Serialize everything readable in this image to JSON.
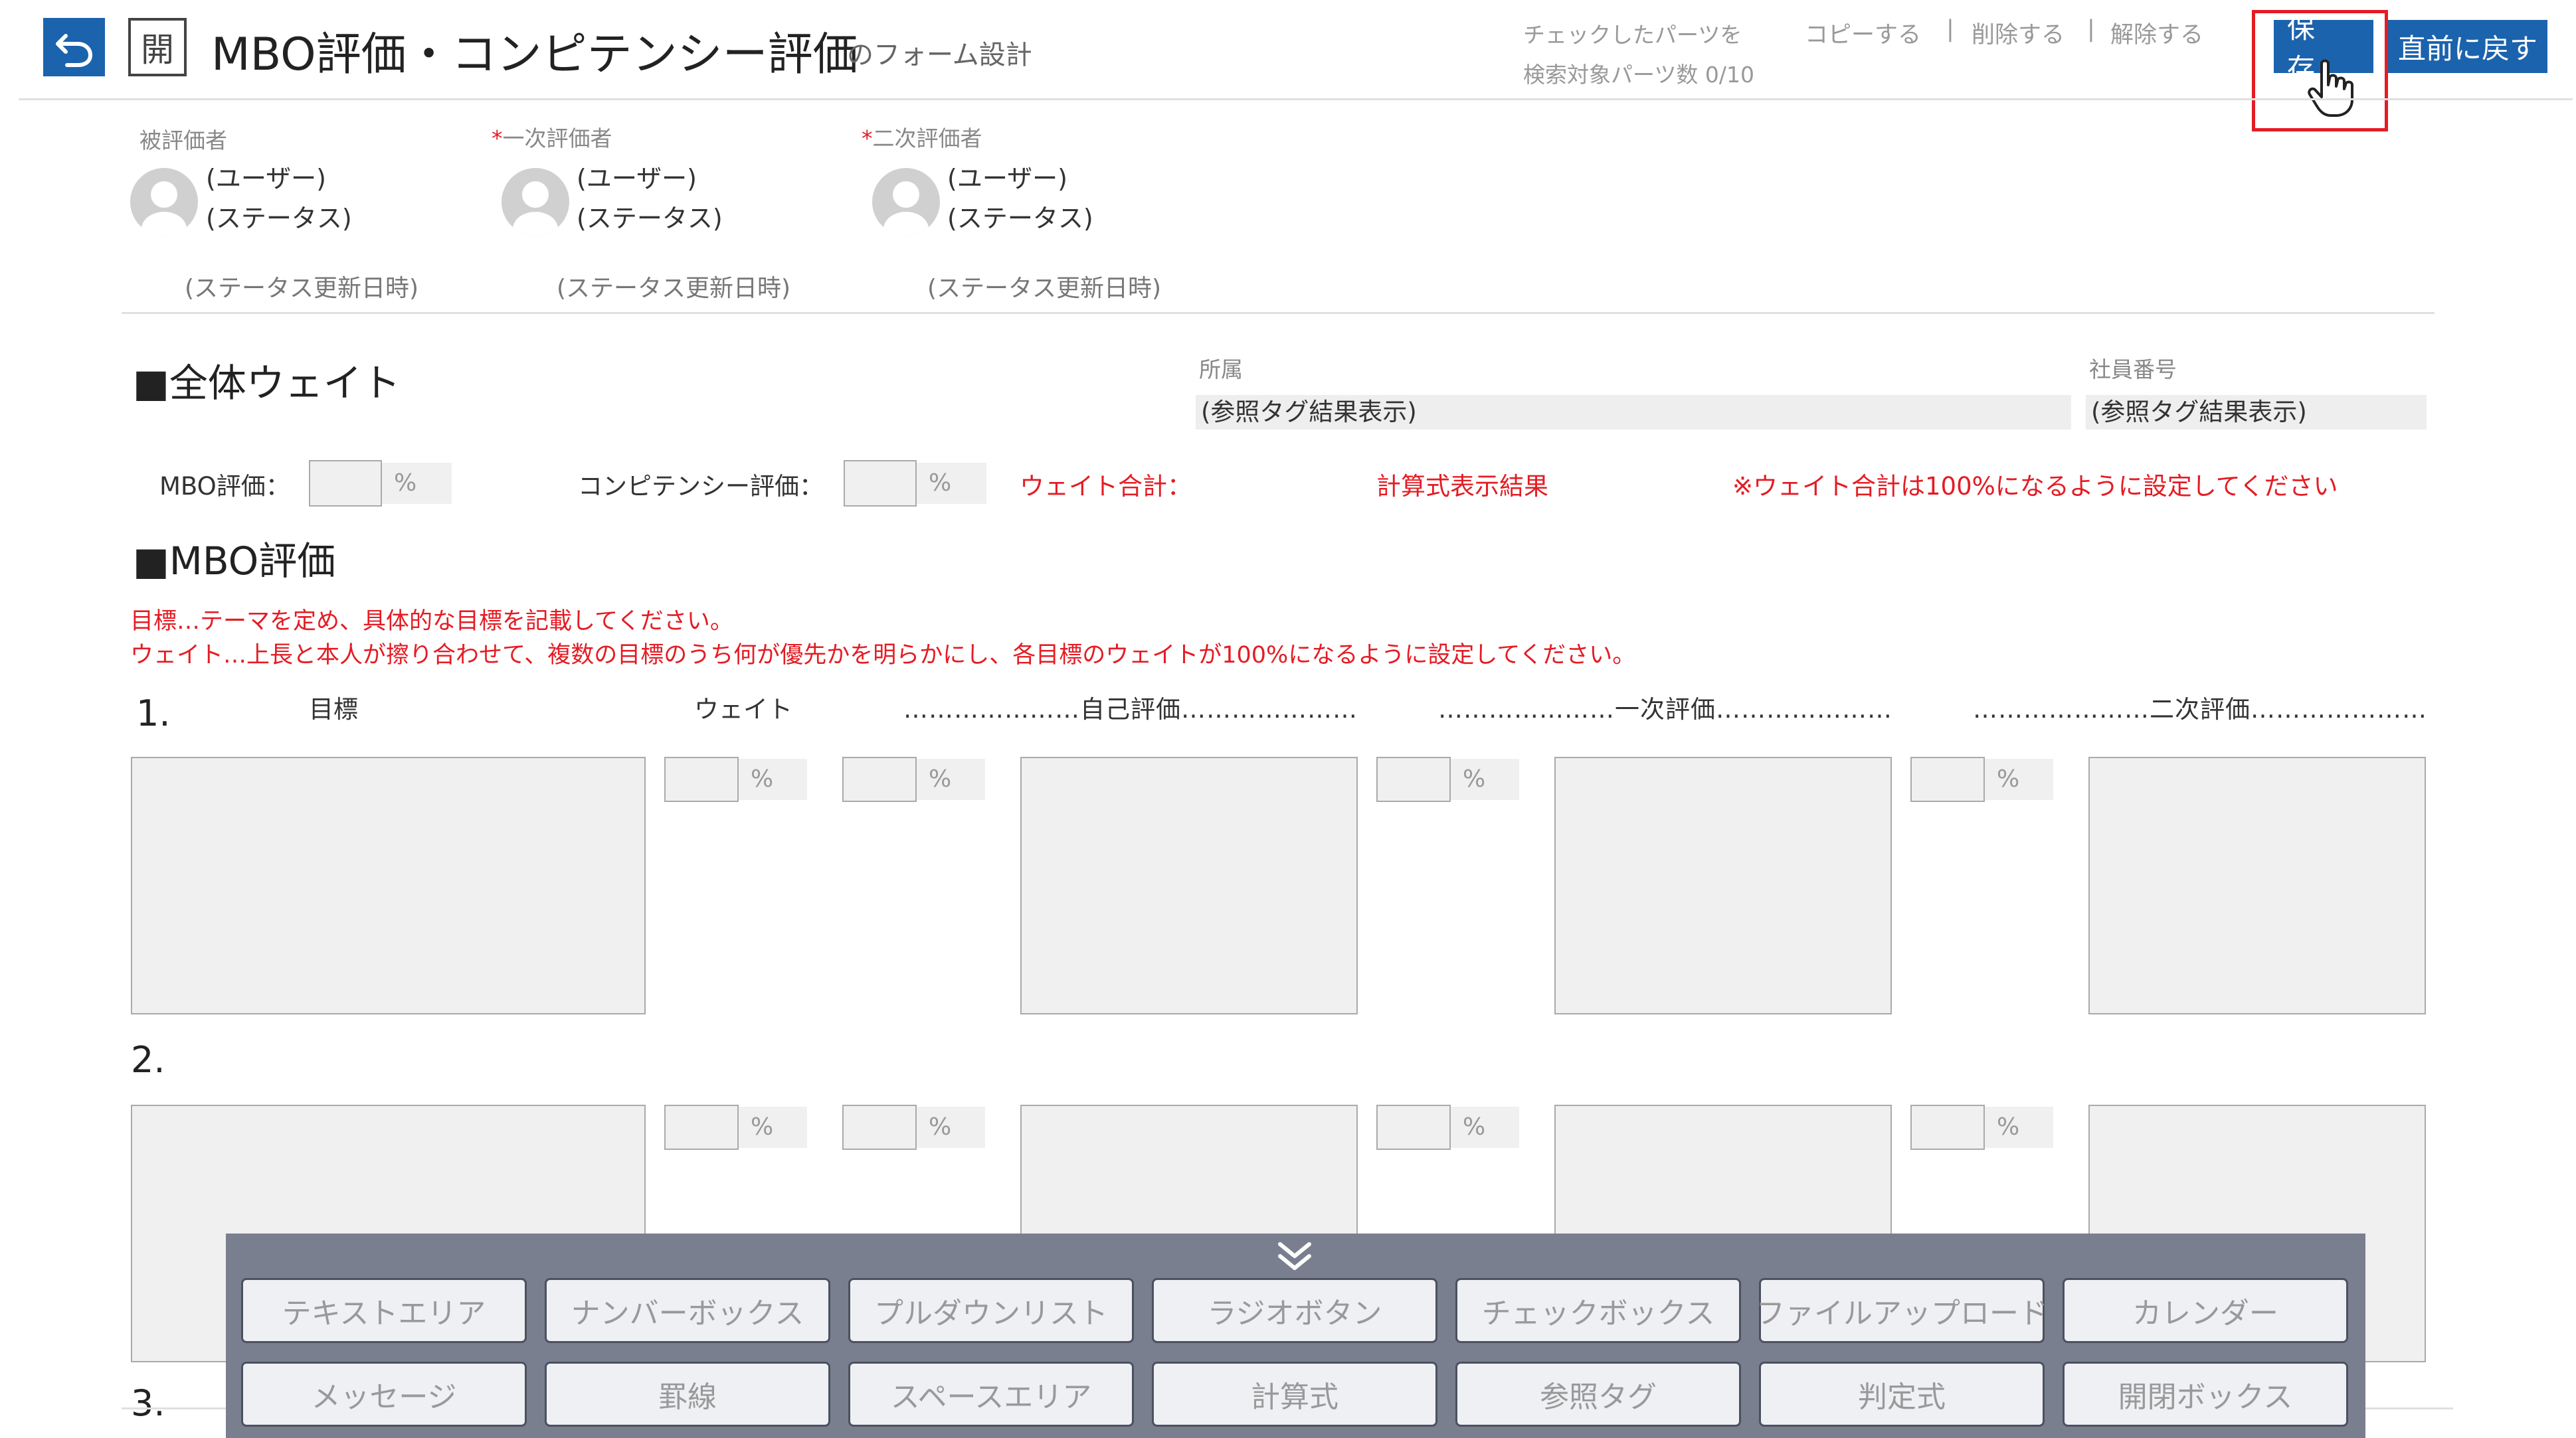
{
  "header": {
    "back_icon": "undo-arrow-icon",
    "open_label": "開",
    "title": "MBO評価・コンピテンシー評価",
    "subtitle": "のフォーム設計",
    "checked_parts_note": "チェックしたパーツを",
    "search_parts_count": "検索対象パーツ数 0/10",
    "copy_label": "コピーする",
    "delete_label": "削除する",
    "release_label": "解除する",
    "separator": "|",
    "save_label": "保存",
    "revert_label": "直前に戻す",
    "cursor_icon": "hand-pointer-icon"
  },
  "evaluators": [
    {
      "label": "被評価者",
      "required": "",
      "user": "(ユーザー)",
      "status": "(ステータス)",
      "date": "(ステータス更新日時)"
    },
    {
      "label": "一次評価者",
      "required": "*",
      "user": "(ユーザー)",
      "status": "(ステータス)",
      "date": "(ステータス更新日時)"
    },
    {
      "label": "二次評価者",
      "required": "*",
      "user": "(ユーザー)",
      "status": "(ステータス)",
      "date": "(ステータス更新日時)"
    }
  ],
  "overall_weight": {
    "title": "■全体ウェイト",
    "department_label": "所属",
    "department_value": "(参照タグ結果表示)",
    "employee_no_label": "社員番号",
    "employee_no_value": "(参照タグ結果表示)",
    "mbo_label": "MBO評価：",
    "competency_label": "コンピテンシー評価：",
    "percent": "%",
    "weight_total_label": "ウェイト合計：",
    "formula_result": "計算式表示結果",
    "weight_note": "※ウェイト合計は100%になるように設定してください"
  },
  "mbo": {
    "title": "■MBO評価",
    "instruction_1": "目標…テーマを定め、具体的な目標を記載してください。",
    "instruction_2": "ウェイト…上長と本人が擦り合わせて、複数の目標のうち何が優先かを明らかにし、各目標のウェイトが100%になるように設定してください。",
    "col_goal": "目標",
    "col_weight": "ウェイト",
    "col_self": "自己評価",
    "col_first": "一次評価",
    "col_second": "二次評価",
    "dots": "…………………",
    "row_numbers": [
      "1.",
      "2.",
      "3."
    ]
  },
  "toolbar": {
    "collapse_icon": "double-chevron-down-icon",
    "row1": [
      "テキストエリア",
      "ナンバーボックス",
      "プルダウンリスト",
      "ラジオボタン",
      "チェックボックス",
      "ファイルアップロード",
      "カレンダー"
    ],
    "row2": [
      "メッセージ",
      "罫線",
      "スペースエリア",
      "計算式",
      "参照タグ",
      "判定式",
      "開閉ボックス"
    ]
  },
  "colors": {
    "primary": "#1c63ad",
    "accent_red": "#e41c24",
    "toolbar_bg": "#7a7f8f"
  }
}
